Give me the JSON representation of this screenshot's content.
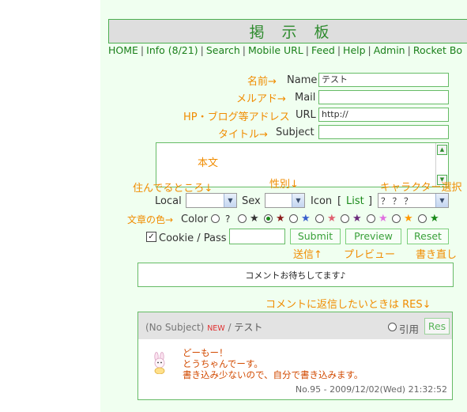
{
  "board": {
    "title": "掲示板"
  },
  "nav": {
    "items": [
      "HOME",
      "Info (8/21)",
      "Search",
      "Mobile URL",
      "Feed",
      "Help",
      "Admin",
      "Rocket Bo"
    ],
    "separator": "|"
  },
  "form": {
    "name": {
      "hint": "名前→",
      "label": "Name",
      "value": "テスト"
    },
    "mail": {
      "hint": "メルアド→",
      "label": "Mail",
      "value": ""
    },
    "url": {
      "hint": "HP・ブログ等アドレス",
      "label": "URL",
      "value": "http://"
    },
    "subject": {
      "hint": "タイトル→",
      "label": "Subject",
      "value": ""
    },
    "body_hint": "本文",
    "local": {
      "hint": "住んでるところ↓",
      "label": "Local",
      "value": ""
    },
    "sex": {
      "hint": "性別↓",
      "label": "Sex",
      "value": ""
    },
    "icon": {
      "hint": "キャラクター選択",
      "label": "Icon",
      "bracket_open": "[",
      "list_link": "List",
      "bracket_close": "]",
      "value": "？ ？ ？"
    },
    "color": {
      "hint": "文章の色→",
      "label": "Color",
      "random_label": "?",
      "options": [
        {
          "color": "#333333",
          "selected": false
        },
        {
          "color": "#8b1a1a",
          "selected": true
        },
        {
          "color": "#3a5fcd",
          "selected": false
        },
        {
          "color": "#e06070",
          "selected": false
        },
        {
          "color": "#6a2a7a",
          "selected": false
        },
        {
          "color": "#e070e0",
          "selected": false
        },
        {
          "color": "#ff9900",
          "selected": false
        },
        {
          "color": "#1a8a1a",
          "selected": false
        }
      ]
    },
    "cookie": {
      "checked": true,
      "label": "Cookie / Pass",
      "value": ""
    },
    "buttons": {
      "submit": "Submit",
      "preview": "Preview",
      "reset": "Reset"
    },
    "button_hints": {
      "submit": "送信↑",
      "preview": "プレビュー",
      "reset": "書き直し"
    }
  },
  "notice": "コメントお待ちしてます♪",
  "reply_hint": "コメントに返信したいときは RES↓",
  "post": {
    "subject": "(No Subject)",
    "new_badge": "NEW",
    "author_sep": "/",
    "author": "テスト",
    "reply_label": "引用",
    "res_button": "Res",
    "body": [
      "どーもー！",
      "とうちゃんでーす。",
      "書き込み少ないので、自分で書き込みます。"
    ],
    "meta": "No.95 - 2009/12/02(Wed) 21:32:52"
  }
}
